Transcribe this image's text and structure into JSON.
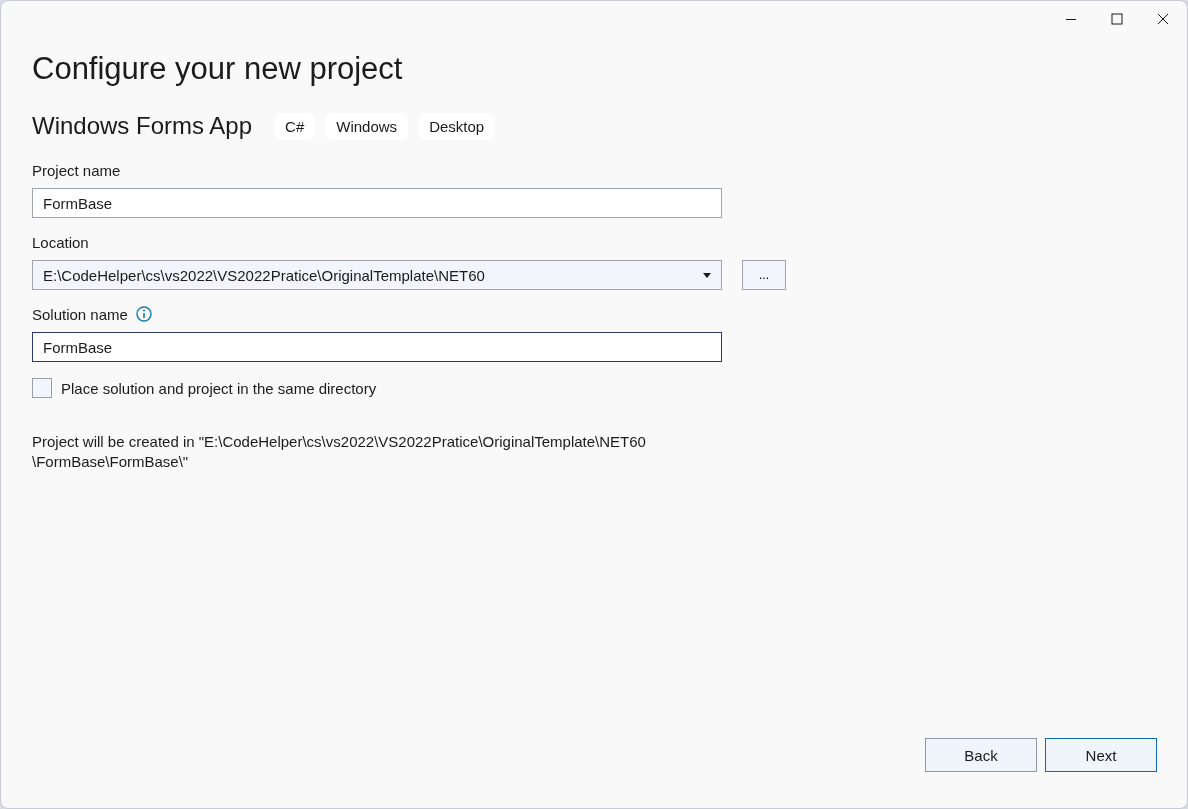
{
  "title": "Configure your new project",
  "template": {
    "name": "Windows Forms App",
    "tags": [
      "C#",
      "Windows",
      "Desktop"
    ]
  },
  "fields": [
    {
      "kind": "text",
      "label": "Project name",
      "value": "FormBase",
      "focused": false,
      "info": false
    },
    {
      "kind": "dropdown",
      "label": "Location",
      "value": "E:\\CodeHelper\\cs\\vs2022\\VS2022Pratice\\OriginalTemplate\\NET60",
      "browse": "...",
      "focused": false,
      "info": false
    },
    {
      "kind": "text",
      "label": "Solution name",
      "value": "FormBase",
      "focused": true,
      "info": true
    }
  ],
  "checkbox": {
    "label": "Place solution and project in the same directory",
    "checked": false
  },
  "summary_lines": [
    "Project will be created in \"E:\\CodeHelper\\cs\\vs2022\\VS2022Pratice\\OriginalTemplate\\NET60",
    "\\FormBase\\FormBase\\\""
  ],
  "buttons": [
    {
      "label": "Back",
      "default": false
    },
    {
      "label": "Next",
      "default": true
    }
  ]
}
